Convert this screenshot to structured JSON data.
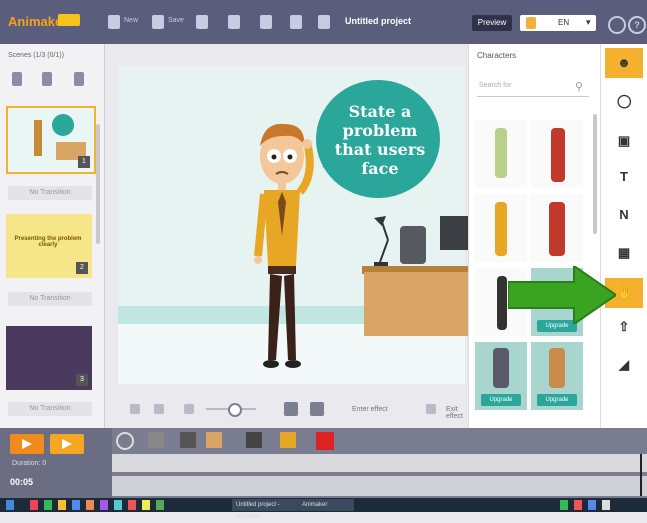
{
  "app": {
    "logo_text": "Animaker",
    "project_title": "Untitled project"
  },
  "toolbar": {
    "new_label": "New",
    "save_label": "Save",
    "preview_label": "Preview",
    "language_value": "EN",
    "help_label": "?"
  },
  "scenes": {
    "title": "Scenes (1/3 (0/1))",
    "items": [
      {
        "transition_label": "No Transition",
        "number": "1"
      },
      {
        "thumb_text": "Presenting the problem clearly",
        "transition_label": "No Transition",
        "number": "2"
      },
      {
        "transition_label": "No Transition",
        "number": "3"
      }
    ]
  },
  "canvas": {
    "speech_text": "State a problem that users face"
  },
  "canvas_tools": {
    "enter_effect_label": "Enter effect",
    "exit_effect_label": "Exit effect"
  },
  "characters": {
    "title": "Characters",
    "search_placeholder": "Search for",
    "upgrade_label": "Upgrade"
  },
  "right_bar": {
    "items": [
      "character-icon",
      "balloon-icon",
      "image-icon",
      "text-icon",
      "number-icon",
      "video-icon",
      "hand-icon",
      "upload-icon",
      "background-icon"
    ]
  },
  "timeline": {
    "duration_label": "Duration: 0",
    "time_value": "00:05"
  },
  "taskbar": {
    "item1": "Untitled project - Animaker",
    "item2": "Animaker"
  },
  "colors": {
    "accent_orange": "#f5b02e",
    "teal": "#2ba69b",
    "topbar": "#5a5d7c",
    "arrow_green": "#3aa321"
  }
}
